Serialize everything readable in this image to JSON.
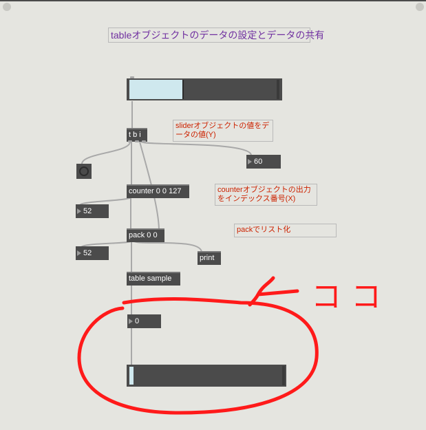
{
  "patch": {
    "title": "tableオブジェクトのデータの設定とデータの共有",
    "comments": {
      "slider_note": "sliderオブジェクトの値をデータの値(Y)",
      "counter_note": "counterオブジェクトの出力をインデックス番号(X)",
      "pack_note": "packでリスト化"
    },
    "objects": {
      "tbi": "t b i",
      "counter": "counter 0 0 127",
      "pack": "pack 0 0",
      "table": "table sample",
      "print": "print"
    },
    "numbers": {
      "slider_value": "60",
      "counter_value": "52",
      "pack_value": "52",
      "table_value": "0"
    },
    "slider": {
      "level": 0.38
    },
    "multislider": {
      "level": 0.0
    }
  },
  "annotation": {
    "arrow_text": "コ コ",
    "color": "#ff1a1a"
  },
  "colors": {
    "background": "#e5e5e0",
    "object": "#4b4b4b",
    "slider_fill": "#cfe8ee",
    "comment_text": "#cc2200",
    "title_text": "#7030a0",
    "wire": "#a8a8a8"
  }
}
